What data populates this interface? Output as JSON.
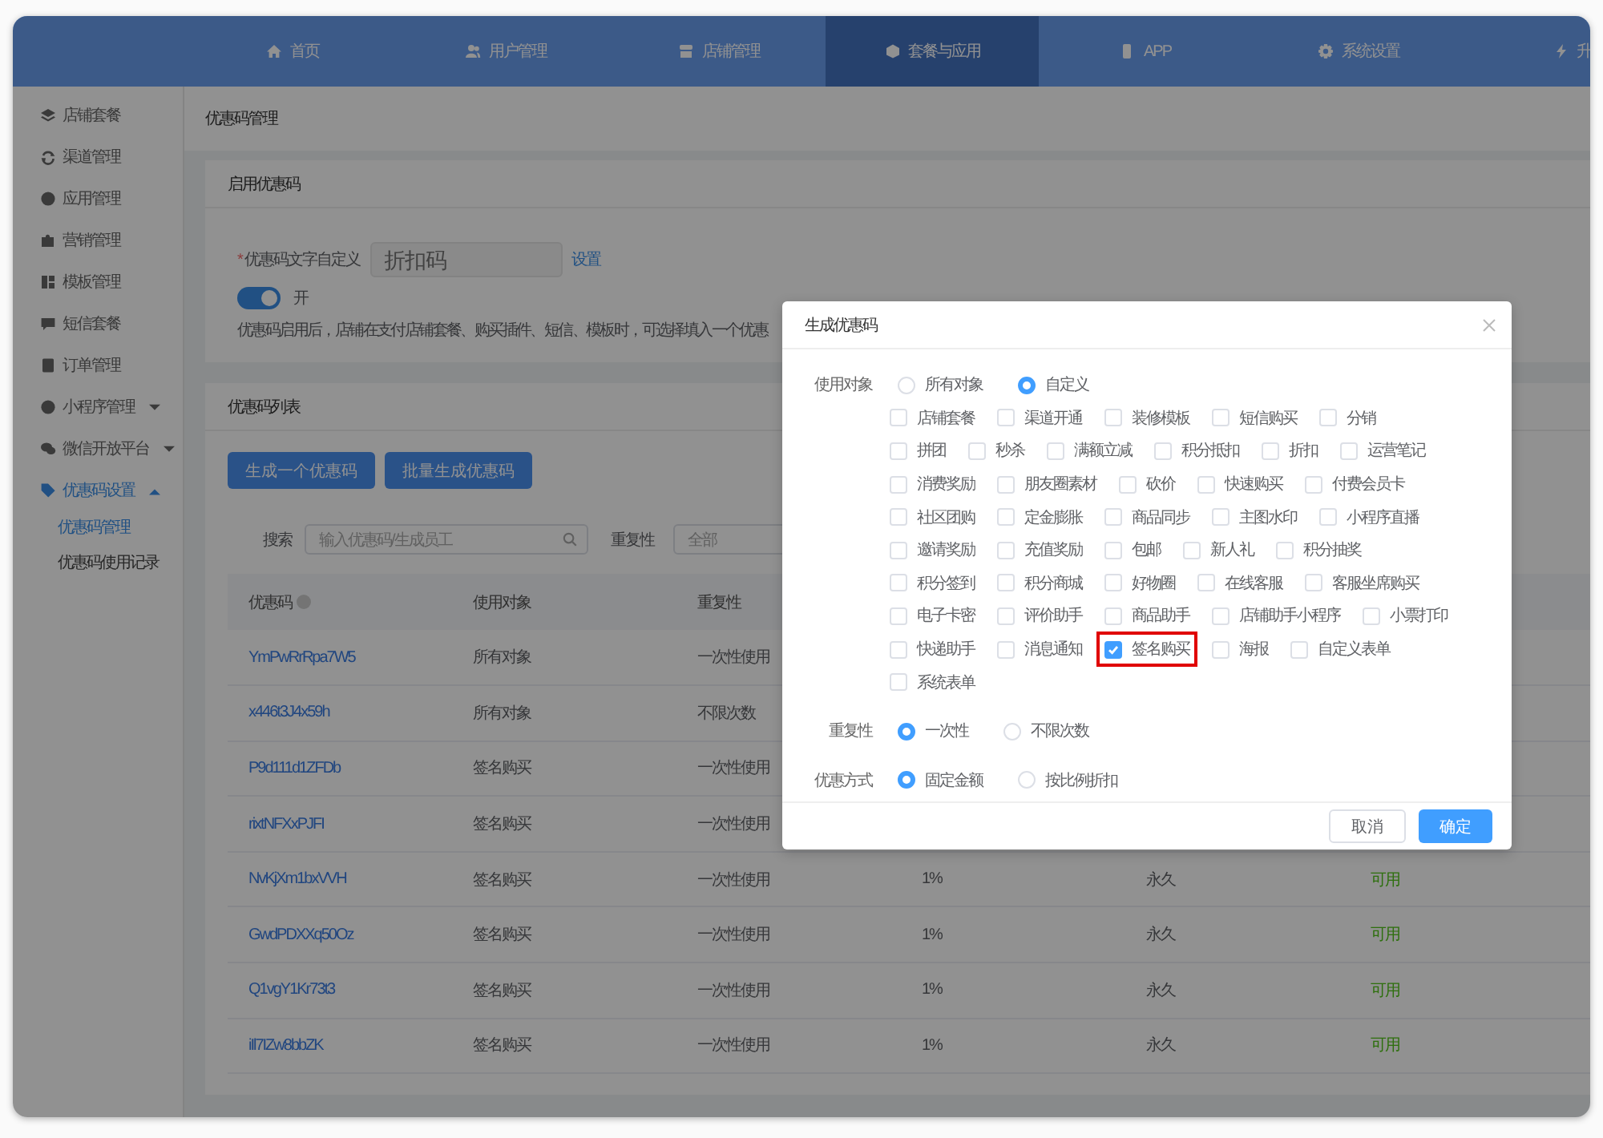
{
  "nav": {
    "items": [
      {
        "label": "首页",
        "kind": "home",
        "selected": false
      },
      {
        "label": "用户管理",
        "kind": "users",
        "selected": false
      },
      {
        "label": "店铺管理",
        "kind": "store",
        "selected": false
      },
      {
        "label": "套餐与应用",
        "kind": "cube",
        "selected": true
      },
      {
        "label": "APP",
        "kind": "phone",
        "selected": false
      },
      {
        "label": "系统设置",
        "kind": "gear",
        "selected": false
      },
      {
        "label": "升",
        "kind": "bolt",
        "selected": false
      }
    ]
  },
  "sidebar": {
    "items": [
      {
        "label": "店铺套餐",
        "kind": "layers",
        "selected": false
      },
      {
        "label": "渠道管理",
        "kind": "cycle",
        "selected": false
      },
      {
        "label": "应用管理",
        "kind": "ball",
        "selected": false
      },
      {
        "label": "营销管理",
        "kind": "puzzle",
        "selected": false
      },
      {
        "label": "模板管理",
        "kind": "grid",
        "selected": false
      },
      {
        "label": "短信套餐",
        "kind": "chat",
        "selected": false
      },
      {
        "label": "订单管理",
        "kind": "doc",
        "selected": false
      },
      {
        "label": "小程序管理",
        "kind": "ball",
        "selected": false,
        "expanded": false
      },
      {
        "label": "微信开放平台",
        "kind": "bubbles",
        "selected": false,
        "expanded": false
      },
      {
        "label": "优惠码设置",
        "kind": "tag",
        "selected": true,
        "expanded": true,
        "children": [
          {
            "label": "优惠码管理",
            "selected": true
          },
          {
            "label": "优惠码使用记录",
            "selected": false
          }
        ]
      }
    ]
  },
  "breadcrumb": "优惠码管理",
  "enable_card": {
    "title": "启用优惠码",
    "required_mark": "*",
    "field_label": "优惠码文字自定义",
    "field_placeholder": "折扣码",
    "link": "设置",
    "on": true,
    "toggle_label": "开",
    "description": "优惠码启用后，店铺在支付店铺套餐、购买插件、短信、模板时，可选择填入一个优惠"
  },
  "list_card": {
    "title": "优惠码列表",
    "buttons": [
      "生成一个优惠码",
      "批量生成优惠码"
    ],
    "search_label": "搜索",
    "search_placeholder": "输入优惠码/生成员工",
    "repeat_label": "重复性",
    "repeat_value": "全部",
    "table": {
      "columns": [
        {
          "label": "优惠码",
          "help": true
        },
        {
          "label": "使用对象",
          "help": false
        },
        {
          "label": "重复性",
          "help": false
        }
      ],
      "rows": [
        {
          "code": "YmPwRrRpa7W5",
          "target": "所有对象",
          "repeat": "一次性使用"
        },
        {
          "code": "x446t3J4x59h",
          "target": "所有对象",
          "repeat": "不限次数"
        },
        {
          "code": "P9d111d1ZFDb",
          "target": "签名购买",
          "repeat": "一次性使用"
        },
        {
          "code": "rixtNFXxPJFI",
          "target": "签名购买",
          "repeat": "一次性使用"
        },
        {
          "code": "NvKjXm1bxVVH",
          "target": "签名购买",
          "repeat": "一次性使用",
          "discount": "1%",
          "validity": "永久",
          "status": "可用"
        },
        {
          "code": "GwdPDXXq50Oz",
          "target": "签名购买",
          "repeat": "一次性使用",
          "discount": "1%",
          "validity": "永久",
          "status": "可用"
        },
        {
          "code": "Q1vgY1Kr73t3",
          "target": "签名购买",
          "repeat": "一次性使用",
          "discount": "1%",
          "validity": "永久",
          "status": "可用"
        },
        {
          "code": "iIl7IZw8bbZK",
          "target": "签名购买",
          "repeat": "一次性使用",
          "discount": "1%",
          "validity": "永久",
          "status": "可用"
        }
      ]
    }
  },
  "dialog": {
    "title": "生成优惠码",
    "target_label": "使用对象",
    "target_choices": [
      {
        "label": "所有对象",
        "selected": false
      },
      {
        "label": "自定义",
        "selected": true
      }
    ],
    "option_rows": [
      [
        {
          "label": "店铺套餐",
          "checked": false,
          "highlighted": false
        },
        {
          "label": "渠道开通",
          "checked": false,
          "highlighted": false
        },
        {
          "label": "装修模板",
          "checked": false,
          "highlighted": false
        },
        {
          "label": "短信购买",
          "checked": false,
          "highlighted": false
        },
        {
          "label": "分销",
          "checked": false,
          "highlighted": false
        }
      ],
      [
        {
          "label": "拼团",
          "checked": false,
          "highlighted": false
        },
        {
          "label": "秒杀",
          "checked": false,
          "highlighted": false
        },
        {
          "label": "满额立减",
          "checked": false,
          "highlighted": false
        },
        {
          "label": "积分抵扣",
          "checked": false,
          "highlighted": false
        },
        {
          "label": "折扣",
          "checked": false,
          "highlighted": false
        },
        {
          "label": "运营笔记",
          "checked": false,
          "highlighted": false
        }
      ],
      [
        {
          "label": "消费奖励",
          "checked": false,
          "highlighted": false
        },
        {
          "label": "朋友圈素材",
          "checked": false,
          "highlighted": false
        },
        {
          "label": "砍价",
          "checked": false,
          "highlighted": false
        },
        {
          "label": "快速购买",
          "checked": false,
          "highlighted": false
        },
        {
          "label": "付费会员卡",
          "checked": false,
          "highlighted": false
        }
      ],
      [
        {
          "label": "社区团购",
          "checked": false,
          "highlighted": false
        },
        {
          "label": "定金膨胀",
          "checked": false,
          "highlighted": false
        },
        {
          "label": "商品同步",
          "checked": false,
          "highlighted": false
        },
        {
          "label": "主图水印",
          "checked": false,
          "highlighted": false
        },
        {
          "label": "小程序直播",
          "checked": false,
          "highlighted": false
        }
      ],
      [
        {
          "label": "邀请奖励",
          "checked": false,
          "highlighted": false
        },
        {
          "label": "充值奖励",
          "checked": false,
          "highlighted": false
        },
        {
          "label": "包邮",
          "checked": false,
          "highlighted": false
        },
        {
          "label": "新人礼",
          "checked": false,
          "highlighted": false
        },
        {
          "label": "积分抽奖",
          "checked": false,
          "highlighted": false
        }
      ],
      [
        {
          "label": "积分签到",
          "checked": false,
          "highlighted": false
        },
        {
          "label": "积分商城",
          "checked": false,
          "highlighted": false
        },
        {
          "label": "好物圈",
          "checked": false,
          "highlighted": false
        },
        {
          "label": "在线客服",
          "checked": false,
          "highlighted": false
        },
        {
          "label": "客服坐席购买",
          "checked": false,
          "highlighted": false
        }
      ],
      [
        {
          "label": "电子卡密",
          "checked": false,
          "highlighted": false
        },
        {
          "label": "评价助手",
          "checked": false,
          "highlighted": false
        },
        {
          "label": "商品助手",
          "checked": false,
          "highlighted": false
        },
        {
          "label": "店铺助手小程序",
          "checked": false,
          "highlighted": false
        },
        {
          "label": "小票打印",
          "checked": false,
          "highlighted": false
        }
      ],
      [
        {
          "label": "快递助手",
          "checked": false,
          "highlighted": false
        },
        {
          "label": "消息通知",
          "checked": false,
          "highlighted": false
        },
        {
          "label": "签名购买",
          "checked": true,
          "highlighted": true
        },
        {
          "label": "海报",
          "checked": false,
          "highlighted": false
        },
        {
          "label": "自定义表单",
          "checked": false,
          "highlighted": false
        }
      ],
      [
        {
          "label": "系统表单",
          "checked": false,
          "highlighted": false
        }
      ]
    ],
    "repeat_label": "重复性",
    "repeat_choices": [
      {
        "label": "一次性",
        "selected": true
      },
      {
        "label": "不限次数",
        "selected": false
      }
    ],
    "mode_label": "优惠方式",
    "mode_choices": [
      {
        "label": "固定金额",
        "selected": true
      },
      {
        "label": "按比例折扣",
        "selected": false
      }
    ],
    "cancel": "取消",
    "confirm": "确定"
  }
}
